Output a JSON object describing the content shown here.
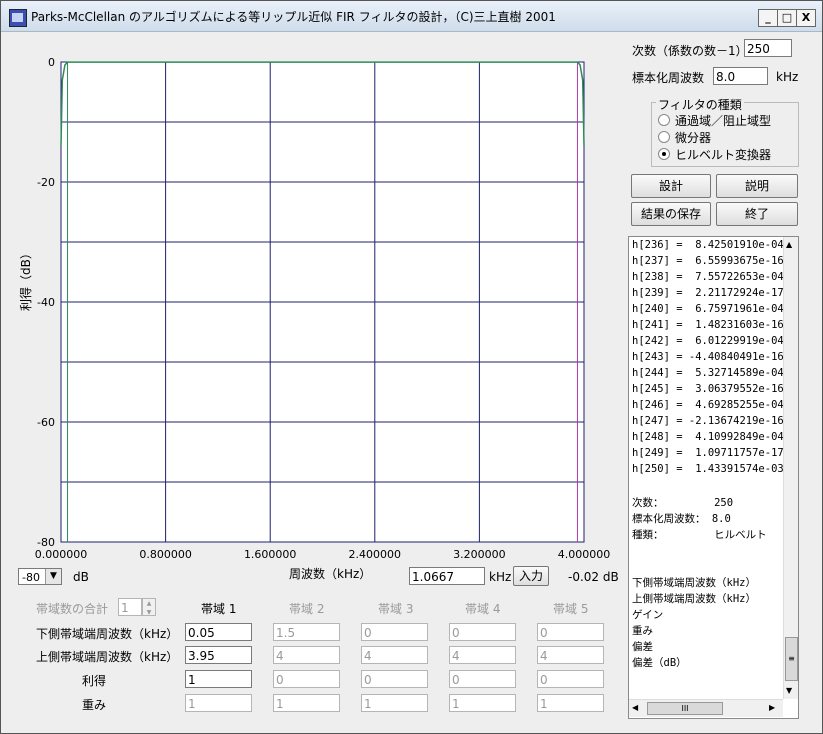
{
  "window": {
    "title": "Parks-McClellan のアルゴリズムによる等リップル近似 FIR フィルタの設計，（C)三上直樹 2001",
    "minimize": "_",
    "maximize": "□",
    "close": "X"
  },
  "plot": {
    "ylabel": "利得（dB）",
    "xlabel": "周波数（kHz）",
    "y_ticks": [
      "0",
      "-20",
      "-40",
      "-60",
      "-80"
    ],
    "x_ticks": [
      "0.000000",
      "0.800000",
      "1.600000",
      "2.400000",
      "3.200000",
      "4.000000"
    ],
    "db_select": "-80",
    "db_unit": "dB",
    "freq_value": "1.0667",
    "freq_unit": "kHz",
    "input_button": "入力",
    "gain_readout": "-0.02  dB"
  },
  "chart_data": {
    "type": "line",
    "xlabel": "周波数（kHz）",
    "ylabel": "利得（dB）",
    "xlim": [
      0,
      4.0
    ],
    "ylim": [
      -80,
      0
    ],
    "grid": true,
    "series": [
      {
        "x": [
          0.0,
          0.01,
          0.03,
          0.05,
          0.1,
          1.0,
          2.0,
          3.0,
          3.9,
          3.95,
          3.97,
          3.99,
          4.0
        ],
        "y": [
          -14,
          -3,
          -0.5,
          -0.02,
          -0.02,
          -0.02,
          -0.02,
          -0.02,
          -0.02,
          -0.02,
          -0.5,
          -3,
          -14
        ]
      }
    ]
  },
  "params": {
    "order_label": "次数（係数の数－1）",
    "order_value": "250",
    "fs_label": "標本化周波数",
    "fs_value": "8.0",
    "fs_unit": "kHz",
    "filter_group_title": "フィルタの種類",
    "filter_types": [
      "通過域／阻止域型",
      "微分器",
      "ヒルベルト変換器"
    ],
    "filter_selected": 2
  },
  "buttons": {
    "design": "設計",
    "help": "説明",
    "save": "結果の保存",
    "exit": "終了"
  },
  "results": {
    "coeffs": [
      "h[236] =  8.42501910e-04",
      "h[237] =  6.55993675e-16",
      "h[238] =  7.55722653e-04",
      "h[239] =  2.21172924e-17",
      "h[240] =  6.75971961e-04",
      "h[241] =  1.48231603e-16",
      "h[242] =  6.01229919e-04",
      "h[243] = -4.40840491e-16",
      "h[244] =  5.32714589e-04",
      "h[245] =  3.06379552e-16",
      "h[246] =  4.69285255e-04",
      "h[247] = -2.13674219e-16",
      "h[248] =  4.10992849e-04",
      "h[249] =  1.09711757e-17",
      "h[250] =  1.43391574e-03"
    ],
    "summary": [
      "次数：        250",
      "標本化周波数： 8.0",
      "種類：        ヒルベルト"
    ],
    "table_rows": [
      "下側帯域端周波数（kHz）",
      "上側帯域端周波数（kHz）",
      "ゲイン",
      "重み",
      "偏差",
      "偏差（dB）"
    ],
    "hscroll_thumb": "III"
  },
  "bands": {
    "count_label": "帯域数の合計",
    "count_value": "1",
    "headers": [
      "帯域 1",
      "帯域 2",
      "帯域 3",
      "帯域 4",
      "帯域 5"
    ],
    "row_labels": [
      "下側帯域端周波数（kHz）",
      "上側帯域端周波数（kHz）",
      "利得",
      "重み"
    ],
    "lower": [
      "0.05",
      "1.5",
      "0",
      "0",
      "0"
    ],
    "upper": [
      "3.95",
      "4",
      "4",
      "4",
      "4"
    ],
    "gain": [
      "1",
      "0",
      "0",
      "0",
      "0"
    ],
    "weight": [
      "1",
      "1",
      "1",
      "1",
      "1"
    ]
  }
}
